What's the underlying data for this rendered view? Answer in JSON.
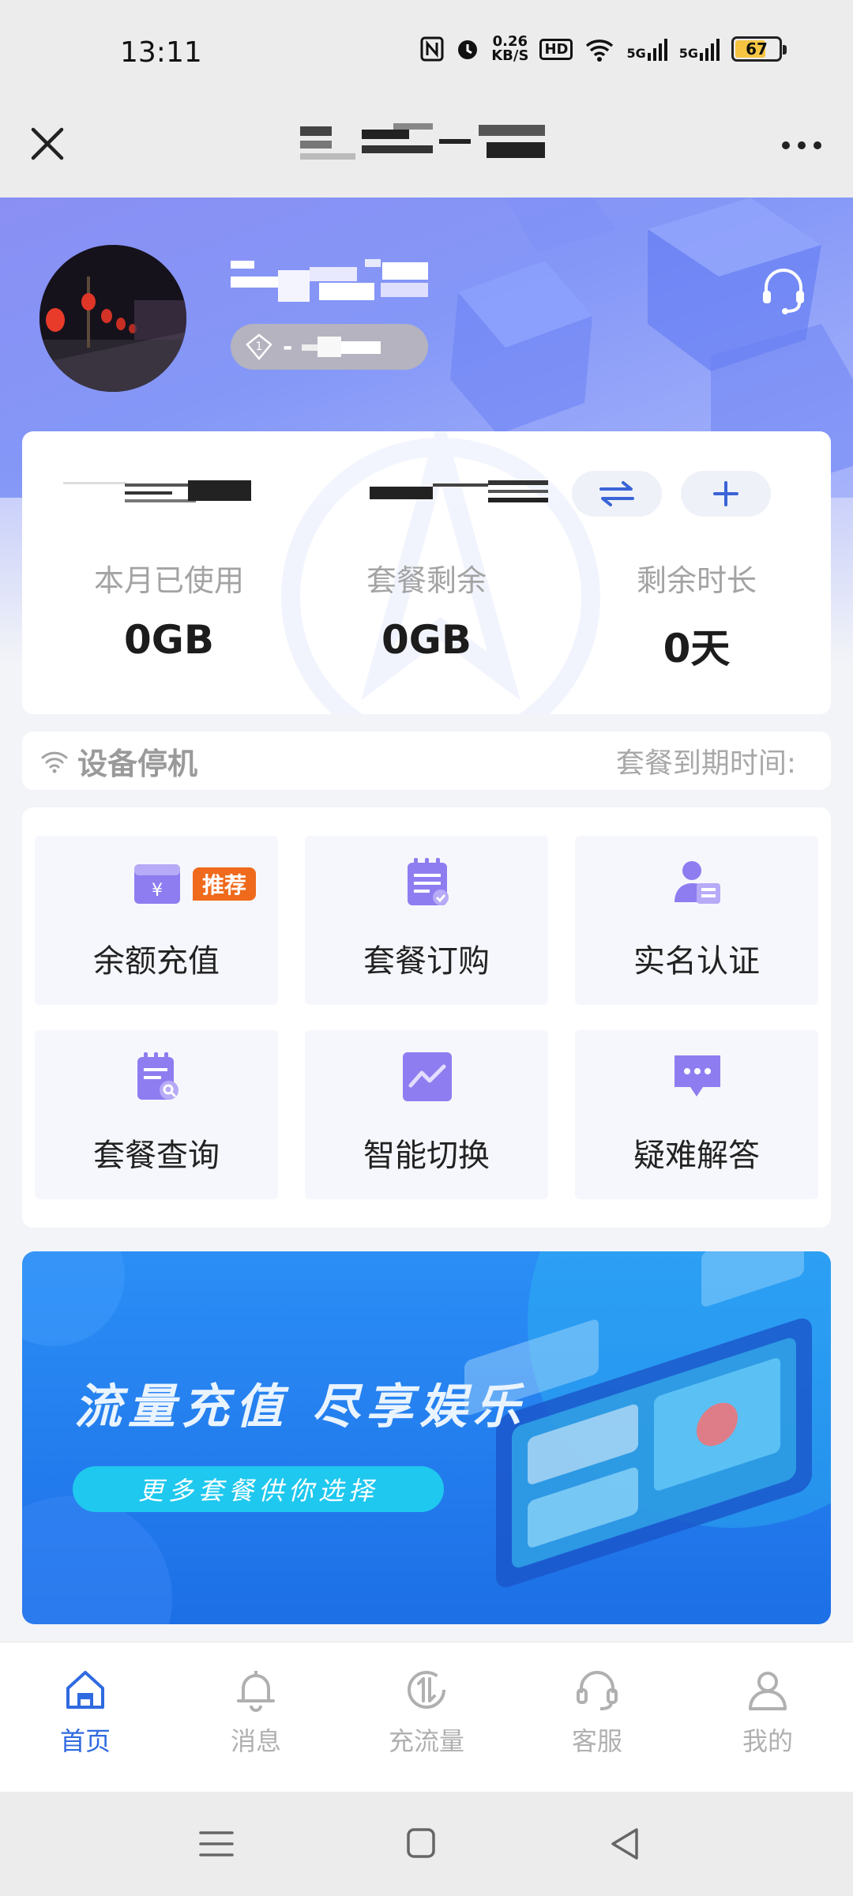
{
  "status_bar": {
    "time": "13:11",
    "speed_value": "0.26",
    "speed_unit": "KB/S",
    "hd_label": "HD",
    "network_1": "5G",
    "network_2": "5G",
    "battery": "67"
  },
  "header": {
    "close_icon": "close-icon",
    "more_icon": "more-dots-icon"
  },
  "user": {
    "level_digit": "1",
    "level_dash": "-"
  },
  "stats": {
    "items": [
      {
        "label": "本月已使用",
        "value": "0GB"
      },
      {
        "label": "套餐剩余",
        "value": "0GB"
      },
      {
        "label": "剩余时长",
        "value": "0天"
      }
    ]
  },
  "device": {
    "status": "设备停机",
    "expire_label": "套餐到期时间:"
  },
  "functions": {
    "items": [
      {
        "label": "余额充值",
        "icon": "wallet-icon",
        "badge": "推荐"
      },
      {
        "label": "套餐订购",
        "icon": "order-list-icon"
      },
      {
        "label": "实名认证",
        "icon": "id-card-icon"
      },
      {
        "label": "套餐查询",
        "icon": "query-list-icon"
      },
      {
        "label": "智能切换",
        "icon": "trend-chart-icon"
      },
      {
        "label": "疑难解答",
        "icon": "chat-bubble-icon"
      }
    ]
  },
  "banner": {
    "title": "流量充值 尽享娱乐",
    "button": "更多套餐供你选择"
  },
  "tabs": {
    "items": [
      {
        "label": "首页",
        "icon": "home-icon",
        "active": true
      },
      {
        "label": "消息",
        "icon": "bell-icon"
      },
      {
        "label": "充流量",
        "icon": "data-recharge-icon"
      },
      {
        "label": "客服",
        "icon": "headset-icon"
      },
      {
        "label": "我的",
        "icon": "user-icon"
      }
    ]
  },
  "colors": {
    "accent": "#2f6ae0",
    "hero": "#8a8ff4",
    "badge": "#ef6a1c",
    "icon_purple": "#7f6fe4"
  }
}
